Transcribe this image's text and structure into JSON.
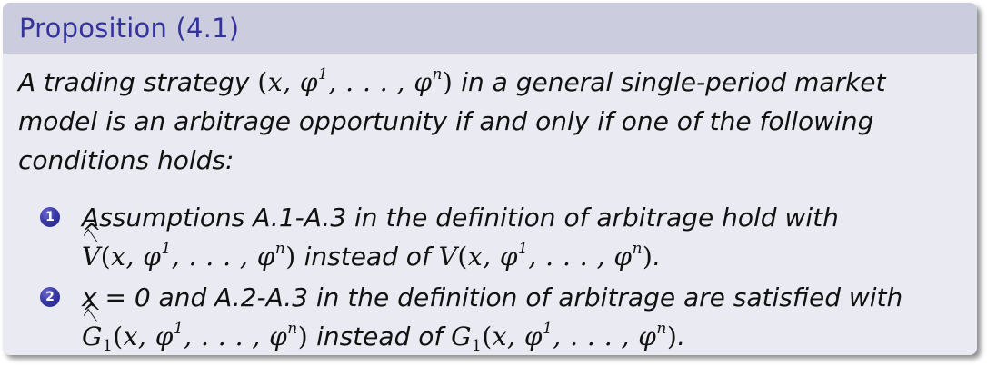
{
  "title": "Proposition (4.1)",
  "statement": {
    "part1": "A trading strategy ",
    "part2": " in a general single-period market model is an arbitrage opportunity if and only if one of the following conditions holds:"
  },
  "items": [
    {
      "bullet": "1",
      "text1": "Assumptions A.1-A.3 in the definition of arbitrage hold with ",
      "text2": " instead of ",
      "text3": "."
    },
    {
      "bullet": "2",
      "text1": "x = 0 and A.2-A.3 in the definition of arbitrage are satisfied with ",
      "text2": " instead of ",
      "text3": "."
    }
  ],
  "colors": {
    "title_text": "#33339b",
    "title_bar": "#ccccdf",
    "body_background": "#eaeaf2",
    "bullet": "#3a3aa8"
  }
}
